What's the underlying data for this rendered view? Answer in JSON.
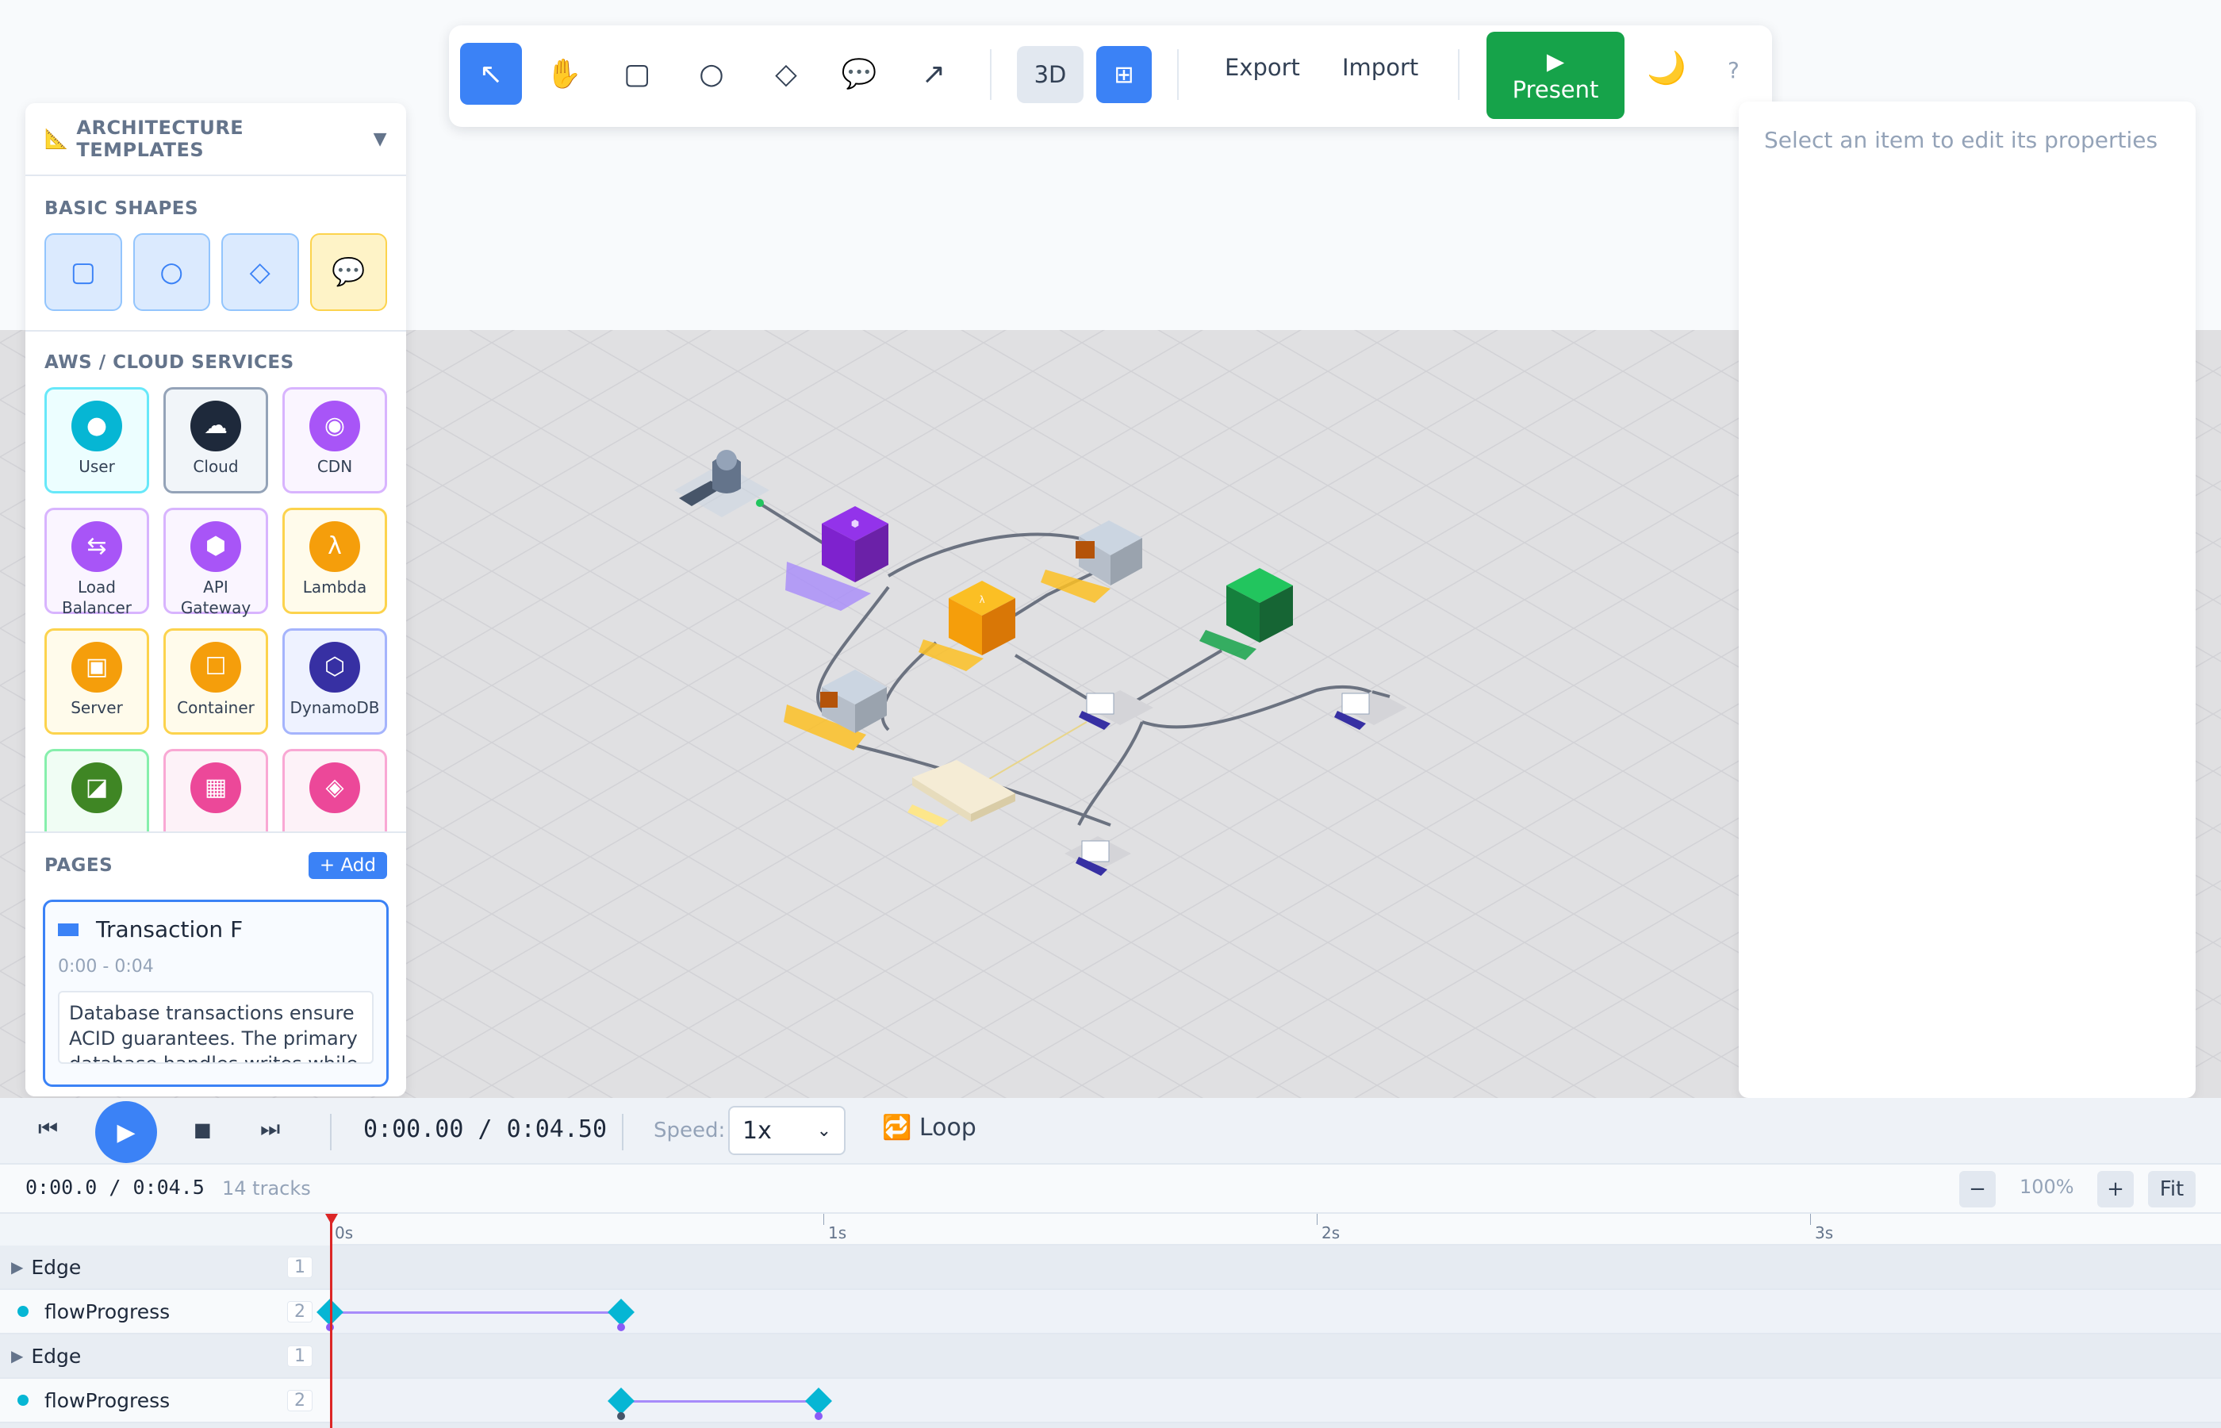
{
  "toolbar": {
    "tools": [
      {
        "name": "select-tool",
        "glyph": "↖",
        "active": true
      },
      {
        "name": "pan-tool",
        "glyph": "✋",
        "active": false
      },
      {
        "name": "rectangle-tool",
        "glyph": "▢",
        "active": false
      },
      {
        "name": "circle-tool",
        "glyph": "○",
        "active": false
      },
      {
        "name": "diamond-tool",
        "glyph": "◇",
        "active": false
      },
      {
        "name": "comment-tool",
        "glyph": "💬",
        "active": false
      },
      {
        "name": "arrow-tool",
        "glyph": "↗",
        "active": false
      }
    ],
    "view_3d_label": "3D",
    "grid_glyph": "⊞",
    "export_label": "Export",
    "import_label": "Import",
    "present_glyph": "▶",
    "present_label": "Present",
    "theme_glyph": "🌙",
    "help_glyph": "?"
  },
  "sidebar": {
    "header_icon": "📐",
    "header_label": "ARCHITECTURE TEMPLATES",
    "header_chevron": "▼",
    "basic_shapes_title": "BASIC SHAPES",
    "basic_shapes": [
      {
        "name": "rectangle",
        "glyph": "▢",
        "style": "blue"
      },
      {
        "name": "circle",
        "glyph": "○",
        "style": "blue"
      },
      {
        "name": "diamond",
        "glyph": "◇",
        "style": "blue"
      },
      {
        "name": "speech-bubble",
        "glyph": "💬",
        "style": "yellow"
      }
    ],
    "services_title": "AWS / CLOUD SERVICES",
    "services": [
      {
        "label": "User",
        "glyph": "●",
        "icon_color": "#06b6d4",
        "bg": "#ecfeff",
        "border": "#67e8f9"
      },
      {
        "label": "Cloud",
        "glyph": "☁",
        "icon_color": "#1e293b",
        "bg": "#f1f5f9",
        "border": "#94a3b8"
      },
      {
        "label": "CDN",
        "glyph": "◉",
        "icon_color": "#a855f7",
        "bg": "#faf5ff",
        "border": "#d8b4fe"
      },
      {
        "label": "Load Balancer",
        "glyph": "⇆",
        "icon_color": "#a855f7",
        "bg": "#faf5ff",
        "border": "#d8b4fe"
      },
      {
        "label": "API Gateway",
        "glyph": "⬢",
        "icon_color": "#a855f7",
        "bg": "#faf5ff",
        "border": "#d8b4fe"
      },
      {
        "label": "Lambda",
        "glyph": "λ",
        "icon_color": "#f59e0b",
        "bg": "#fffbeb",
        "border": "#fcd34d"
      },
      {
        "label": "Server",
        "glyph": "▣",
        "icon_color": "#f59e0b",
        "bg": "#fffbeb",
        "border": "#fcd34d"
      },
      {
        "label": "Container",
        "glyph": "☐",
        "icon_color": "#f59e0b",
        "bg": "#fffbeb",
        "border": "#fcd34d"
      },
      {
        "label": "DynamoDB",
        "glyph": "⬡",
        "icon_color": "#3730a3",
        "bg": "#eef2ff",
        "border": "#a5b4fc"
      },
      {
        "label": "",
        "glyph": "◪",
        "icon_color": "#3f8624",
        "bg": "#f0fdf4",
        "border": "#86efac"
      },
      {
        "label": "",
        "glyph": "▦",
        "icon_color": "#ec4899",
        "bg": "#fdf2f8",
        "border": "#f9a8d4"
      },
      {
        "label": "",
        "glyph": "◈",
        "icon_color": "#ec4899",
        "bg": "#fdf2f8",
        "border": "#f9a8d4"
      }
    ],
    "pages_title": "PAGES",
    "pages_add_label": "+ Add",
    "page": {
      "title": "Transaction F",
      "time_range": "0:00 - 0:04",
      "description": "Database transactions ensure ACID guarantees. The primary database handles writes while"
    }
  },
  "properties_panel": {
    "hint": "Select an item to edit its properties"
  },
  "playback": {
    "skip_back_glyph": "⏮",
    "play_glyph": "▶",
    "stop_glyph": "■",
    "skip_forward_glyph": "⏭",
    "time": "0:00.00 / 0:04.50",
    "speed_label": "Speed:",
    "speed_value": "1x",
    "speed_caret": "⌄",
    "loop_icon": "🔁",
    "loop_label": "Loop"
  },
  "timeline": {
    "time": "0:00.0 / 0:04.5",
    "tracks_count": "14 tracks",
    "zoom_out_label": "−",
    "zoom_value": "100%",
    "zoom_in_label": "+",
    "fit_label": "Fit",
    "ruler": [
      "0s",
      "1s",
      "2s",
      "3s"
    ],
    "tracks": [
      {
        "label": "Edge",
        "kind": "group",
        "count": "1"
      },
      {
        "label": "flowProgress",
        "kind": "sub",
        "count": "2"
      },
      {
        "label": "Edge",
        "kind": "group",
        "count": "1"
      },
      {
        "label": "flowProgress",
        "kind": "sub",
        "count": "2"
      },
      {
        "label": "Edge",
        "kind": "group",
        "count": "1"
      }
    ],
    "keyframes_seconds": [
      {
        "track": 1,
        "from": 0.0,
        "to": 0.59
      },
      {
        "track": 3,
        "from": 0.59,
        "to": 0.99
      }
    ]
  },
  "colors": {
    "accent": "#3b82f6",
    "present": "#16a34a",
    "playhead": "#dc2626",
    "keyframe": "#06b6d4"
  }
}
